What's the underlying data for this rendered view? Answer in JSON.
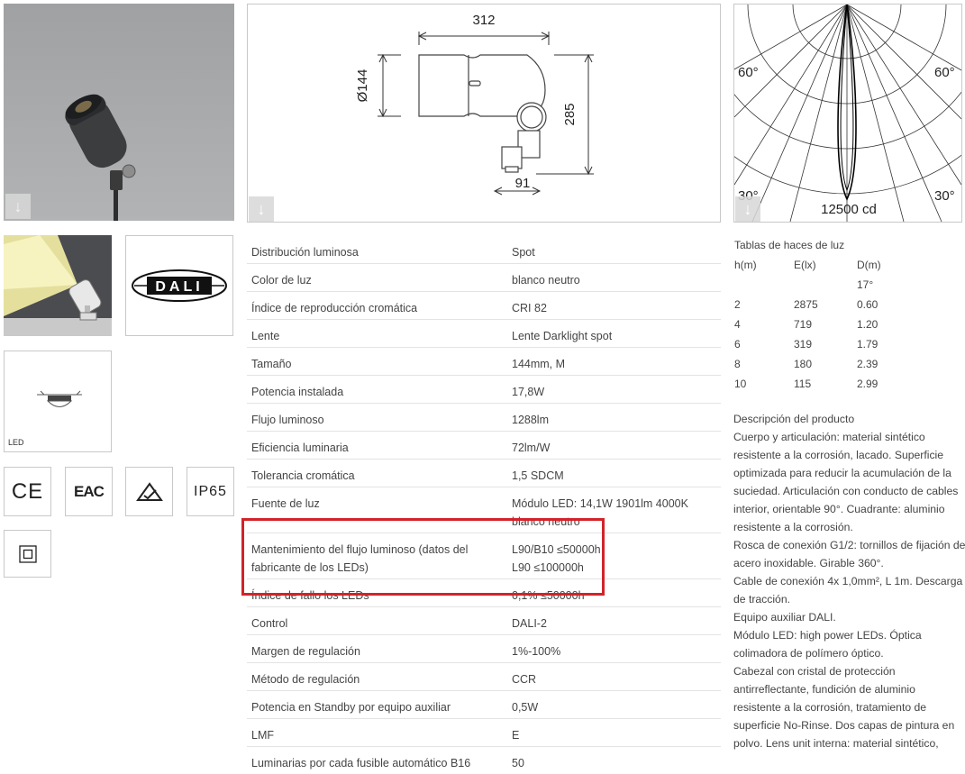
{
  "dimensions": {
    "width_label": "312",
    "diameter_label": "Ø144",
    "height_label": "285",
    "base_label": "91"
  },
  "polar": {
    "angle_left_top": "60°",
    "angle_right_top": "60°",
    "angle_left_bottom": "30°",
    "angle_right_bottom": "30°",
    "intensity_label": "12500 cd"
  },
  "thumbnails": {
    "dali_label": "DALI",
    "led_label": "LED",
    "ip_label": "IP65",
    "ce_label": "CE",
    "eac_label": "EAC"
  },
  "specs": [
    {
      "label": "Distribución luminosa",
      "value": "Spot"
    },
    {
      "label": "Color de luz",
      "value": "blanco neutro"
    },
    {
      "label": "Índice de reproducción cromática",
      "value": "CRI 82"
    },
    {
      "label": "Lente",
      "value": "Lente Darklight spot"
    },
    {
      "label": "Tamaño",
      "value": "144mm, M"
    },
    {
      "label": "Potencia instalada",
      "value": "17,8W"
    },
    {
      "label": "Flujo luminoso",
      "value": "1288lm"
    },
    {
      "label": "Eficiencia luminaria",
      "value": "72lm/W"
    },
    {
      "label": "Tolerancia cromática",
      "value": "1,5 SDCM"
    },
    {
      "label": "Fuente de luz",
      "value": "Módulo LED: 14,1W 1901lm 4000K blanco neutro"
    },
    {
      "label": "Mantenimiento del flujo luminoso (datos del fabricante de los LEDs)",
      "value": "L90/B10 ≤50000h L90 ≤100000h"
    },
    {
      "label": "Índice de fallo los LEDs",
      "value": "0,1% ≤50000h"
    },
    {
      "label": "Control",
      "value": "DALI-2"
    },
    {
      "label": "Margen de regulación",
      "value": "1%-100%"
    },
    {
      "label": "Método de regulación",
      "value": "CCR"
    },
    {
      "label": "Potencia en Standby por equipo auxiliar",
      "value": "0,5W"
    },
    {
      "label": "LMF",
      "value": "E"
    },
    {
      "label": "Luminarias por cada fusible automático B16",
      "value": "50"
    }
  ],
  "beam_table": {
    "title": "Tablas de haces de luz",
    "headers": [
      "h(m)",
      "E(lx)",
      "D(m)"
    ],
    "angle": "17°",
    "rows": [
      [
        "2",
        "2875",
        "0.60"
      ],
      [
        "4",
        "719",
        "1.20"
      ],
      [
        "6",
        "319",
        "1.79"
      ],
      [
        "8",
        "180",
        "2.39"
      ],
      [
        "10",
        "115",
        "2.99"
      ]
    ]
  },
  "description": {
    "title": "Descripción del producto",
    "paragraphs": [
      "Cuerpo y articulación: material sintético resistente a la corrosión, lacado. Superficie optimizada para reducir la acumulación de la suciedad. Articulación con conducto de cables interior, orientable 90°. Cuadrante: aluminio resistente a la corrosión.",
      "Rosca de conexión G1/2: tornillos de fijación de acero inoxidable. Girable 360°.",
      "Cable de conexión 4x 1,0mm², L 1m. Descarga de tracción.",
      "Equipo auxiliar DALI.",
      "Módulo LED: high power LEDs. Óptica colimadora de polímero óptico.",
      "Cabezal con cristal de protección antirreflectante, fundición de aluminio resistente a la corrosión, tratamiento de superficie No-Rinse. Dos capas de pintura en polvo. Lens unit interna: material sintético,"
    ]
  },
  "colors": {
    "highlight": "#d2232a",
    "photo_bg": "#a7a9ab",
    "row_shade": "#f4f4f4"
  },
  "icons": [
    "download-arrow-icon",
    "ce-mark-icon",
    "eac-mark-icon",
    "rcm-mark-icon",
    "class-ii-icon"
  ]
}
